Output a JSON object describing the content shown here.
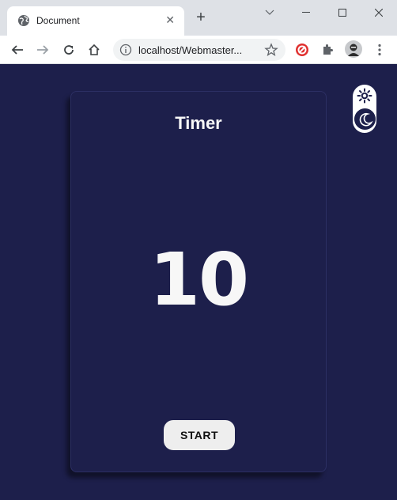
{
  "browser": {
    "tab_title": "Document",
    "tab_close": "✕",
    "new_tab": "+",
    "url": "localhost/Webmaster...",
    "icons": [
      "globe-icon",
      "back-icon",
      "forward-icon",
      "reload-icon",
      "home-icon",
      "info-icon",
      "star-icon",
      "extension-icon",
      "puzzle-icon",
      "profile-avatar"
    ]
  },
  "timer": {
    "title": "Timer",
    "count": "10",
    "start_label": "START"
  },
  "theme": {
    "options": [
      "sun-icon",
      "moon-icon"
    ],
    "active": "dark"
  },
  "colors": {
    "background": "#1d1f4b",
    "text": "#f7f7f7",
    "button_bg": "#eeeeee"
  }
}
